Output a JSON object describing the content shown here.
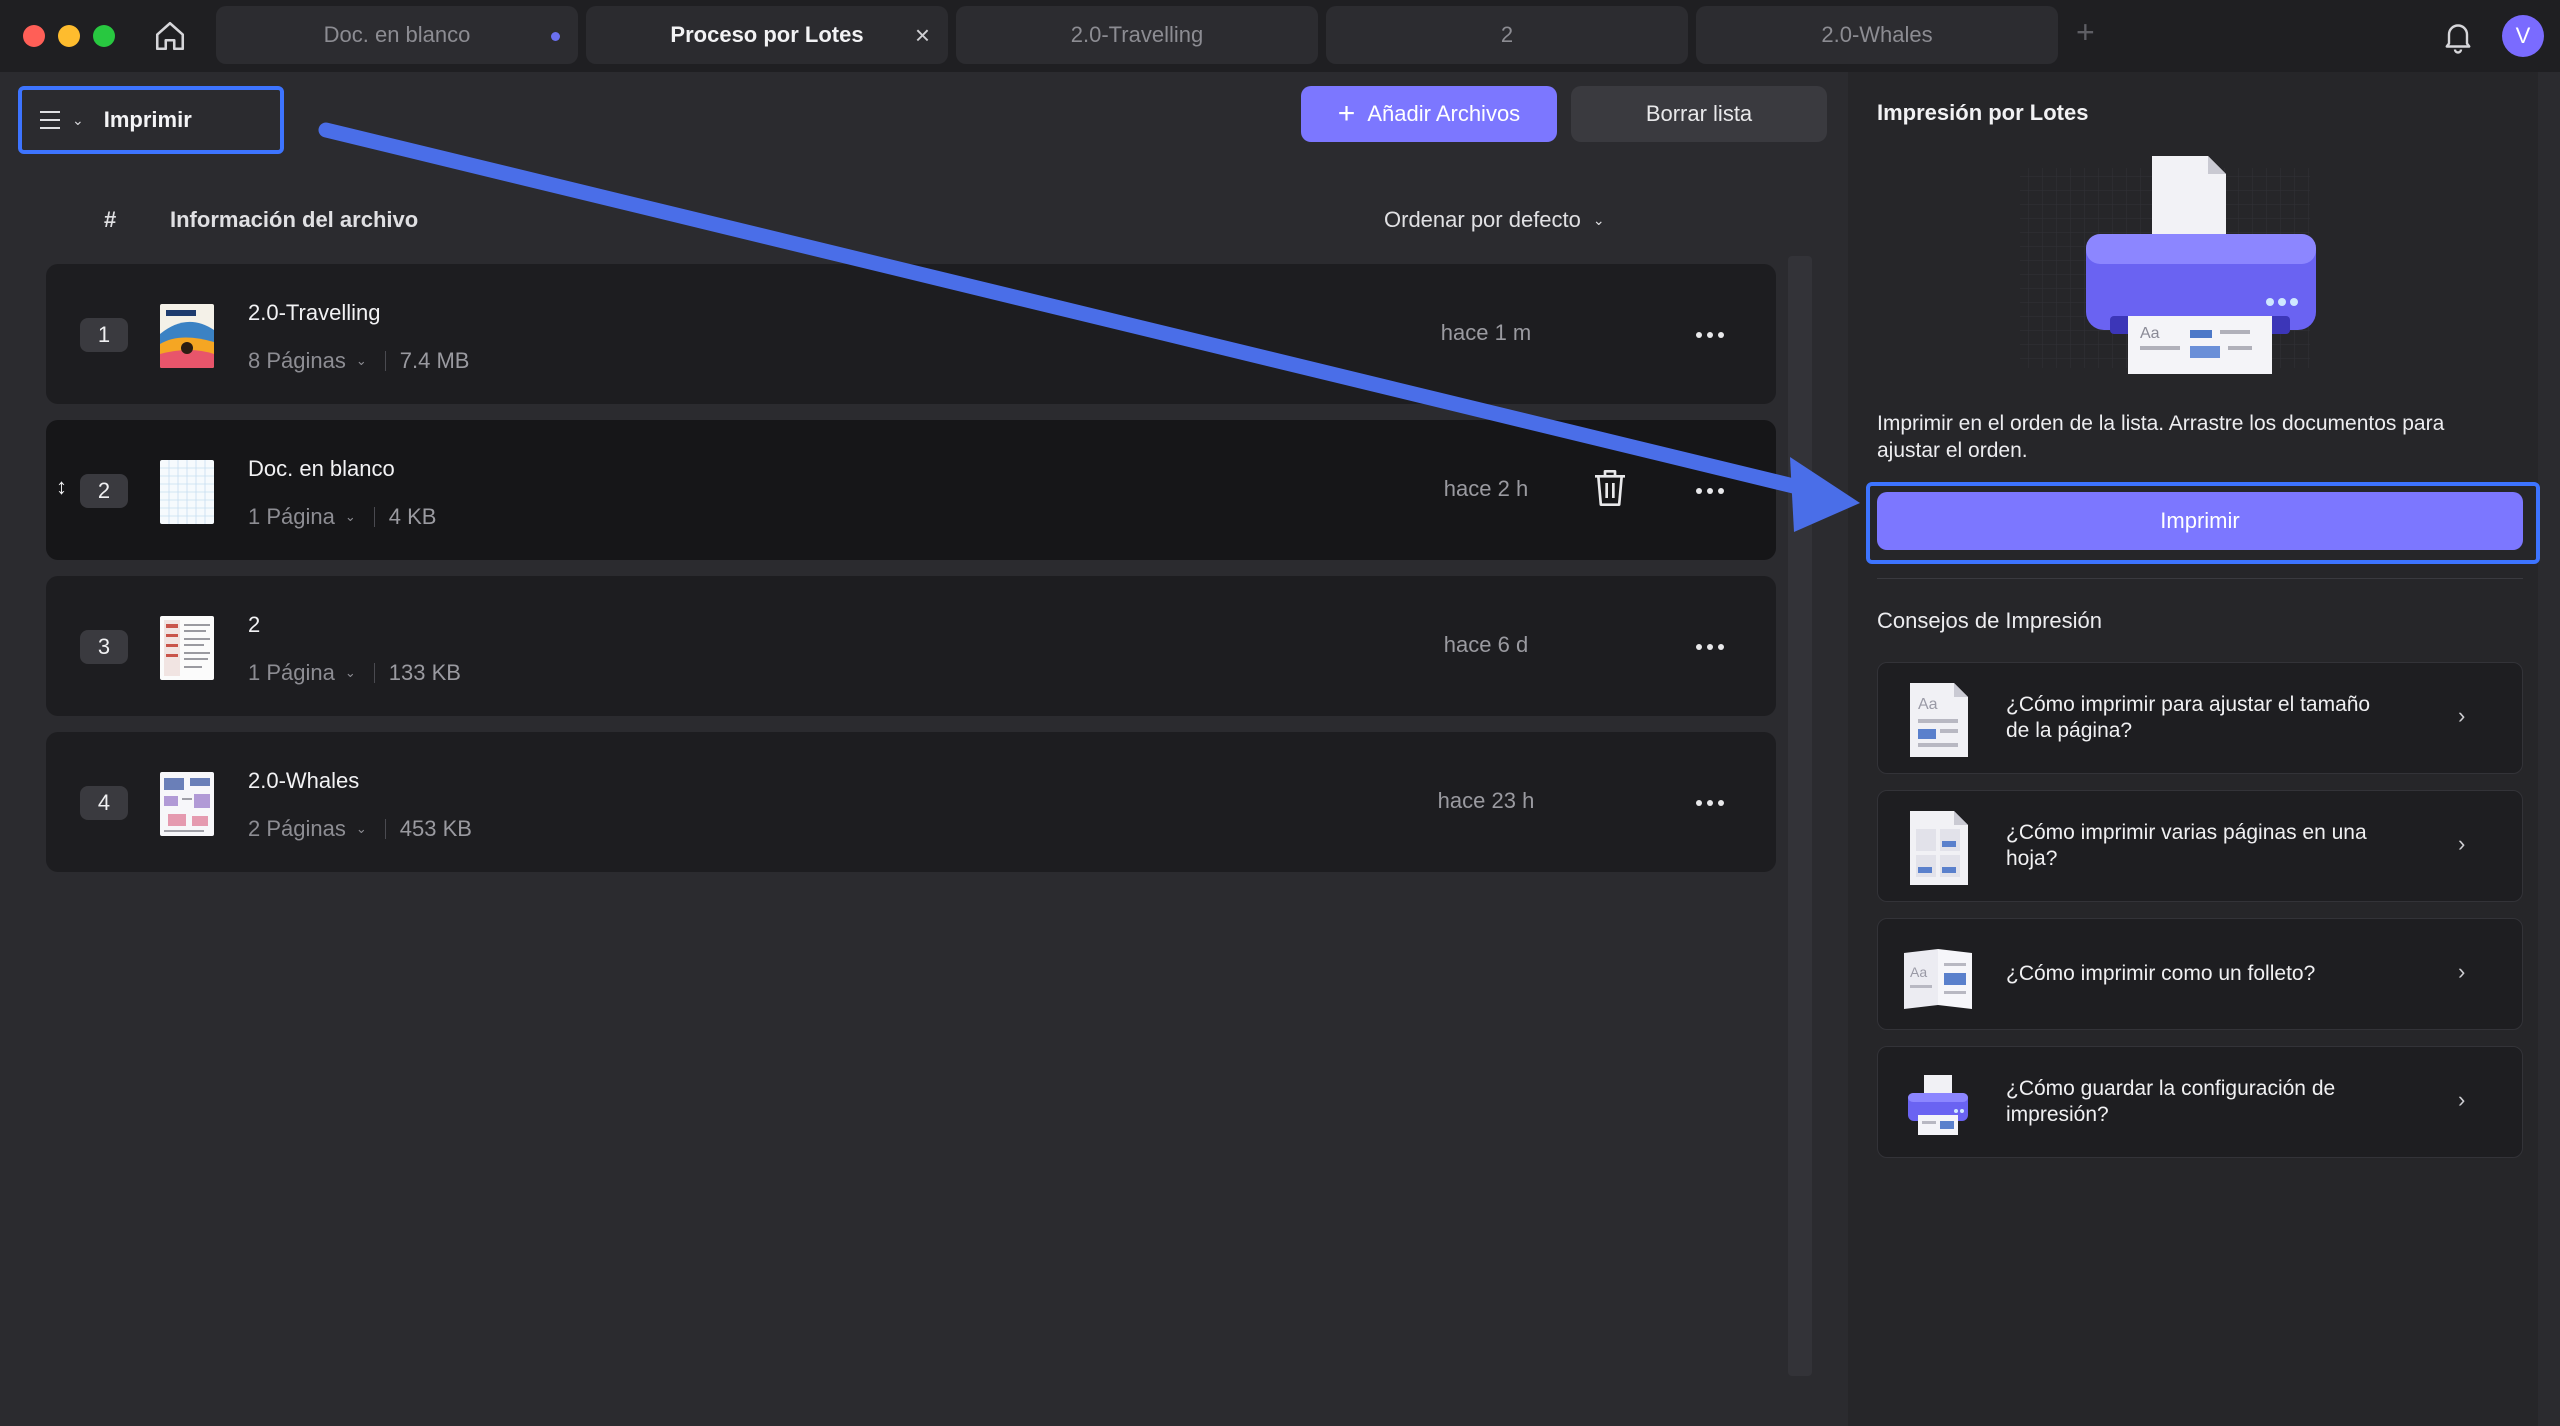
{
  "tabs": [
    {
      "label": "Doc. en blanco",
      "state": "unsaved"
    },
    {
      "label": "Proceso por Lotes",
      "state": "active"
    },
    {
      "label": "2.0-Travelling",
      "state": "normal"
    },
    {
      "label": "2",
      "state": "normal"
    },
    {
      "label": "2.0-Whales",
      "state": "normal"
    }
  ],
  "tab_close": "×",
  "new_tab": "+",
  "avatar_initial": "V",
  "toolbar": {
    "menu_label": "Imprimir",
    "add_files": "Añadir Archivos",
    "clear_list": "Borrar lista"
  },
  "list": {
    "col_number": "#",
    "col_info": "Información del archivo",
    "sort_label": "Ordenar por defecto",
    "files": [
      {
        "num": "1",
        "name": "2.0-Travelling",
        "pages": "8 Páginas",
        "size": "7.4 MB",
        "time": "hace 1 m"
      },
      {
        "num": "2",
        "name": "Doc. en blanco",
        "pages": "1 Página",
        "size": "4 KB",
        "time": "hace 2 h"
      },
      {
        "num": "3",
        "name": "2",
        "pages": "1 Página",
        "size": "133 KB",
        "time": "hace 6 d"
      },
      {
        "num": "4",
        "name": "2.0-Whales",
        "pages": "2 Páginas",
        "size": "453 KB",
        "time": "hace 23 h"
      }
    ]
  },
  "panel": {
    "title": "Impresión por Lotes",
    "description": "Imprimir en el orden de la lista. Arrastre los documentos para ajustar el orden.",
    "print_button": "Imprimir",
    "tips_title": "Consejos de Impresión",
    "tips": [
      "¿Cómo imprimir para ajustar el tamaño de la página?",
      "¿Cómo imprimir varias páginas en una hoja?",
      "¿Cómo imprimir como un folleto?",
      "¿Cómo guardar la configuración de impresión?"
    ]
  },
  "colors": {
    "accent": "#7c77ff",
    "highlight_border": "#3d74ff",
    "annotation_arrow": "#4a6ee8"
  }
}
